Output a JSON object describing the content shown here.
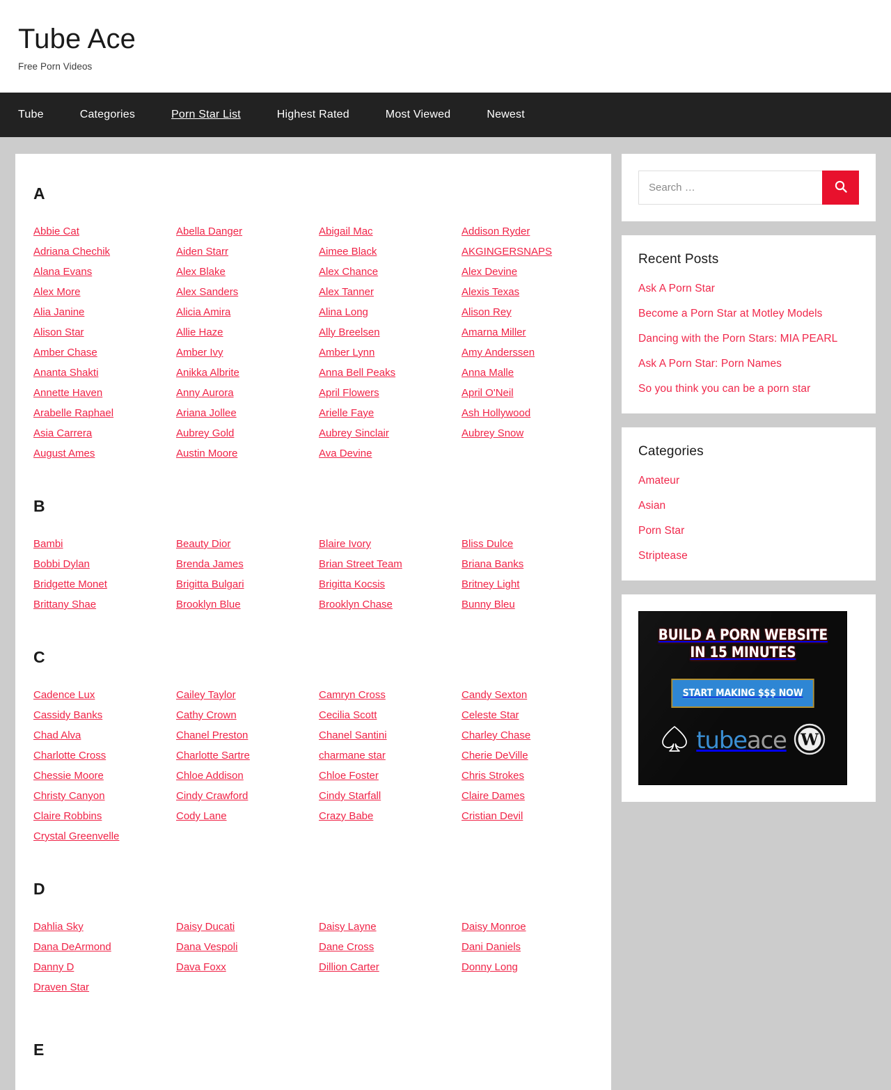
{
  "site": {
    "title": "Tube Ace",
    "tagline": "Free Porn Videos"
  },
  "nav": {
    "items": [
      {
        "label": "Tube",
        "current": false
      },
      {
        "label": "Categories",
        "current": false
      },
      {
        "label": "Porn Star List",
        "current": true
      },
      {
        "label": "Highest Rated",
        "current": false
      },
      {
        "label": "Most Viewed",
        "current": false
      },
      {
        "label": "Newest",
        "current": false
      }
    ]
  },
  "search": {
    "placeholder": "Search …",
    "value": "",
    "button_icon": "search-icon",
    "button_color": "#e8112d"
  },
  "colors": {
    "link_red": "#f02347",
    "page_background": "#cccccc",
    "nav_background": "#222222",
    "card_background": "#ffffff"
  },
  "sections": [
    {
      "letter": "A",
      "columns": [
        [
          "Abbie Cat",
          "Adriana Chechik",
          "Alana Evans",
          "Alex More",
          "Alia Janine",
          "Alison Star",
          "Amber Chase",
          "Ananta Shakti",
          "Annette Haven",
          "Arabelle Raphael",
          "Asia Carrera",
          "August Ames"
        ],
        [
          "Abella Danger",
          "Aiden Starr",
          "Alex Blake",
          "Alex Sanders",
          "Alicia Amira",
          "Allie Haze",
          "Amber Ivy",
          "Anikka Albrite",
          "Anny Aurora",
          "Ariana Jollee",
          "Aubrey Gold",
          "Austin Moore"
        ],
        [
          "Abigail Mac",
          "Aimee Black",
          "Alex Chance",
          "Alex Tanner",
          "Alina Long",
          "Ally Breelsen",
          "Amber Lynn",
          "Anna Bell Peaks",
          "April Flowers",
          "Arielle Faye",
          "Aubrey Sinclair",
          "Ava Devine"
        ],
        [
          "Addison Ryder",
          "AKGINGERSNAPS",
          "Alex Devine",
          "Alexis Texas",
          "Alison Rey",
          "Amarna Miller",
          "Amy Anderssen",
          "Anna Malle",
          "April O'Neil",
          "Ash Hollywood",
          "Aubrey Snow"
        ]
      ]
    },
    {
      "letter": "B",
      "columns": [
        [
          "Bambi",
          "Bobbi Dylan",
          "Bridgette Monet",
          "Brittany Shae"
        ],
        [
          "Beauty Dior",
          "Brenda James",
          "Brigitta Bulgari",
          "Brooklyn Blue"
        ],
        [
          "Blaire Ivory",
          "Brian Street Team",
          "Brigitta Kocsis",
          "Brooklyn Chase"
        ],
        [
          "Bliss Dulce",
          "Briana Banks",
          "Britney Light",
          "Bunny Bleu"
        ]
      ]
    },
    {
      "letter": "C",
      "columns": [
        [
          "Cadence Lux",
          "Cassidy Banks",
          "Chad Alva",
          "Charlotte Cross",
          "Chessie Moore",
          "Christy Canyon",
          "Claire Robbins",
          "Crystal Greenvelle"
        ],
        [
          "Cailey Taylor",
          "Cathy Crown",
          "Chanel Preston",
          "Charlotte Sartre",
          "Chloe Addison",
          "Cindy Crawford",
          "Cody Lane"
        ],
        [
          "Camryn Cross",
          "Cecilia Scott",
          "Chanel Santini",
          "charmane star",
          "Chloe Foster",
          "Cindy Starfall",
          "Crazy Babe"
        ],
        [
          "Candy Sexton",
          "Celeste Star",
          "Charley Chase",
          "Cherie DeVille",
          "Chris Strokes",
          "Claire Dames",
          "Cristian Devil"
        ]
      ]
    },
    {
      "letter": "D",
      "columns": [
        [
          "Dahlia Sky",
          "Dana DeArmond",
          "Danny D",
          "Draven Star"
        ],
        [
          "Daisy Ducati",
          "Dana Vespoli",
          "Dava Foxx"
        ],
        [
          "Daisy Layne",
          "Dane Cross",
          "Dillion Carter"
        ],
        [
          "Daisy Monroe",
          "Dani Daniels",
          "Donny Long"
        ]
      ]
    }
  ],
  "cut_section_letter": "E",
  "sidebar": {
    "recent_posts": {
      "title": "Recent Posts",
      "items": [
        "Ask A Porn Star",
        "Become a Porn Star at Motley Models",
        "Dancing with the Porn Stars: MIA PEARL",
        "Ask A Porn Star: Porn Names",
        "So you think you can be a porn star"
      ]
    },
    "categories": {
      "title": "Categories",
      "items": [
        "Amateur",
        "Asian",
        "Porn Star",
        "Striptease"
      ]
    },
    "ad": {
      "headline": "BUILD A PORN WEBSITE\nIN 15 MINUTES",
      "cta": "START MAKING $$$ NOW",
      "brand_first": "tube",
      "brand_second": "ace"
    }
  }
}
